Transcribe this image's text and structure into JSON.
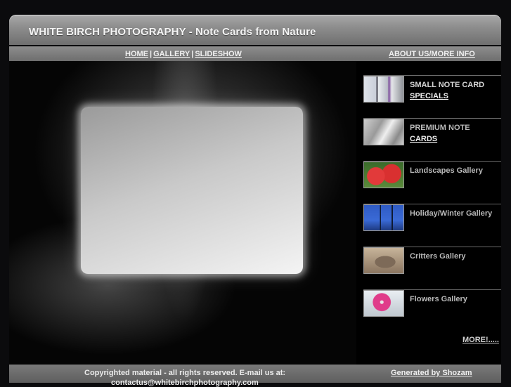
{
  "header": {
    "title": "WHITE BIRCH PHOTOGRAPHY - Note Cards from Nature"
  },
  "nav": {
    "home": "HOME",
    "gallery": "GALLERY",
    "slideshow": "SLIDESHOW",
    "separator": "|",
    "about": "ABOUT US/MORE INFO"
  },
  "sidebar": {
    "items": [
      {
        "line1": "SMALL NOTE CARD",
        "line2": "SPECIALS",
        "thumb": "note-cards-thumbnail"
      },
      {
        "line1": "PREMIUM NOTE",
        "line2": "CARDS",
        "thumb": "premium-cards-thumbnail"
      },
      {
        "line1": "Landscapes Gallery",
        "line2": "",
        "thumb": "red-flowers-thumbnail"
      },
      {
        "line1": "Holiday/Winter Gallery",
        "line2": "",
        "thumb": "blue-sky-thumbnail"
      },
      {
        "line1": "Critters Gallery",
        "line2": "",
        "thumb": "toad-thumbnail"
      },
      {
        "line1": "Flowers Gallery",
        "line2": "",
        "thumb": "pink-flower-thumbnail"
      }
    ],
    "more": "MORE!....."
  },
  "footer": {
    "copyright": "Copyrighted material - all rights reserved. E-mail us at:",
    "email": "contactus@whitebirchphotography.com",
    "generated": "Generated by Shozam"
  },
  "colors": {
    "background": "#0b0b0d",
    "header": "#8e8e8e",
    "text": "#f0f0f0"
  }
}
